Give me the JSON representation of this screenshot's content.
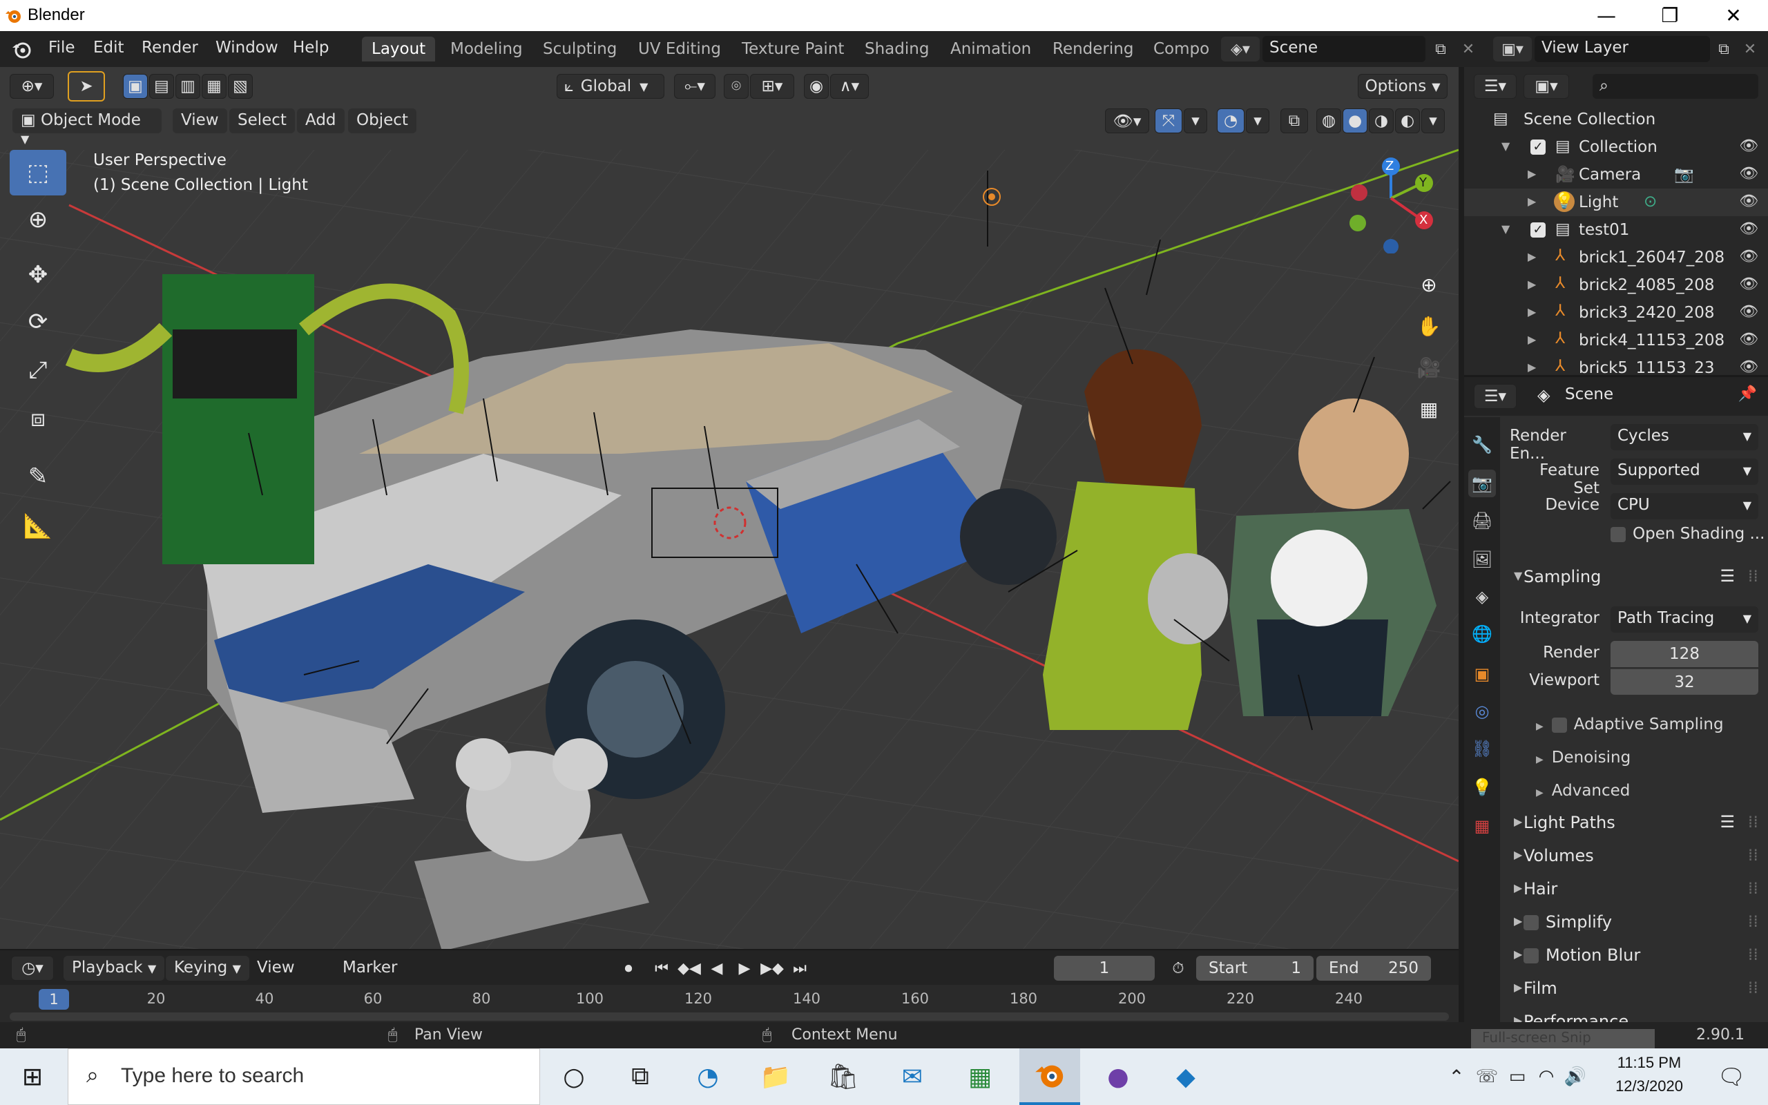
{
  "window": {
    "title": "Blender",
    "minimize": "—",
    "maximize": "❐",
    "close": "✕"
  },
  "menu": [
    "File",
    "Edit",
    "Render",
    "Window",
    "Help"
  ],
  "workspaces": [
    {
      "label": "Layout",
      "active": true
    },
    {
      "label": "Modeling"
    },
    {
      "label": "Sculpting"
    },
    {
      "label": "UV Editing"
    },
    {
      "label": "Texture Paint"
    },
    {
      "label": "Shading"
    },
    {
      "label": "Animation"
    },
    {
      "label": "Rendering"
    },
    {
      "label": "Compo"
    }
  ],
  "scene_field": "Scene",
  "view_layer_field": "View Layer",
  "viewport": {
    "transform_orientation": "Global",
    "options_label": "Options",
    "mode": "Object Mode",
    "header_menus": [
      "View",
      "Select",
      "Add",
      "Object"
    ],
    "info_line1": "User Perspective",
    "info_line2": "(1) Scene Collection | Light",
    "gizmo_axes": [
      "Z",
      "Y",
      "X"
    ]
  },
  "outliner": {
    "root": "Scene Collection",
    "rows": [
      {
        "name": "Collection",
        "icon": "collection-icon",
        "level": 1,
        "expanded": true,
        "checked": true
      },
      {
        "name": "Camera",
        "icon": "camera-object-icon",
        "level": 2
      },
      {
        "name": "Light",
        "icon": "light-object-icon",
        "level": 2
      },
      {
        "name": "test01",
        "icon": "collection-icon",
        "level": 1,
        "expanded": true,
        "checked": true
      },
      {
        "name": "brick1_26047_208",
        "icon": "armature-icon",
        "level": 2
      },
      {
        "name": "brick2_4085_208",
        "icon": "armature-icon",
        "level": 2
      },
      {
        "name": "brick3_2420_208",
        "icon": "armature-icon",
        "level": 2
      },
      {
        "name": "brick4_11153_208",
        "icon": "armature-icon",
        "level": 2
      },
      {
        "name": "brick5_11153_23",
        "icon": "armature-icon",
        "level": 2
      }
    ]
  },
  "properties": {
    "context": "Scene",
    "render_engine_label": "Render En...",
    "render_engine": "Cycles",
    "feature_set_label": "Feature Set",
    "feature_set": "Supported",
    "device_label": "Device",
    "device": "CPU",
    "open_shading_label": "Open Shading ...",
    "sampling_label": "Sampling",
    "integrator_label": "Integrator",
    "integrator": "Path Tracing",
    "render_label": "Render",
    "render_samples": "128",
    "viewport_label": "Viewport",
    "viewport_samples": "32",
    "sub_panels": [
      "Adaptive Sampling",
      "Denoising",
      "Advanced"
    ],
    "panels": [
      "Light Paths",
      "Volumes",
      "Hair",
      "Simplify",
      "Motion Blur",
      "Film",
      "Performance"
    ]
  },
  "timeline": {
    "menus": [
      "Playback",
      "Keying",
      "View",
      "Marker"
    ],
    "current_frame": "1",
    "start_label": "Start",
    "start": "1",
    "end_label": "End",
    "end": "250",
    "ruler_current": "1",
    "ticks": [
      "20",
      "40",
      "60",
      "80",
      "100",
      "120",
      "140",
      "160",
      "180",
      "200",
      "220",
      "240"
    ]
  },
  "statusbar": {
    "pan": "Pan View",
    "context": "Context Menu",
    "version": "2.90.1",
    "snip": "Full-screen Snip"
  },
  "taskbar": {
    "search_placeholder": "Type here to search",
    "time": "11:15 PM",
    "date": "12/3/2020"
  },
  "colors": {
    "accent": "#4772b3",
    "header": "#232323",
    "viewport": "#393939",
    "x_axis": "#d4303e",
    "y_axis": "#7fb51f",
    "z_axis": "#2f7fe0"
  }
}
